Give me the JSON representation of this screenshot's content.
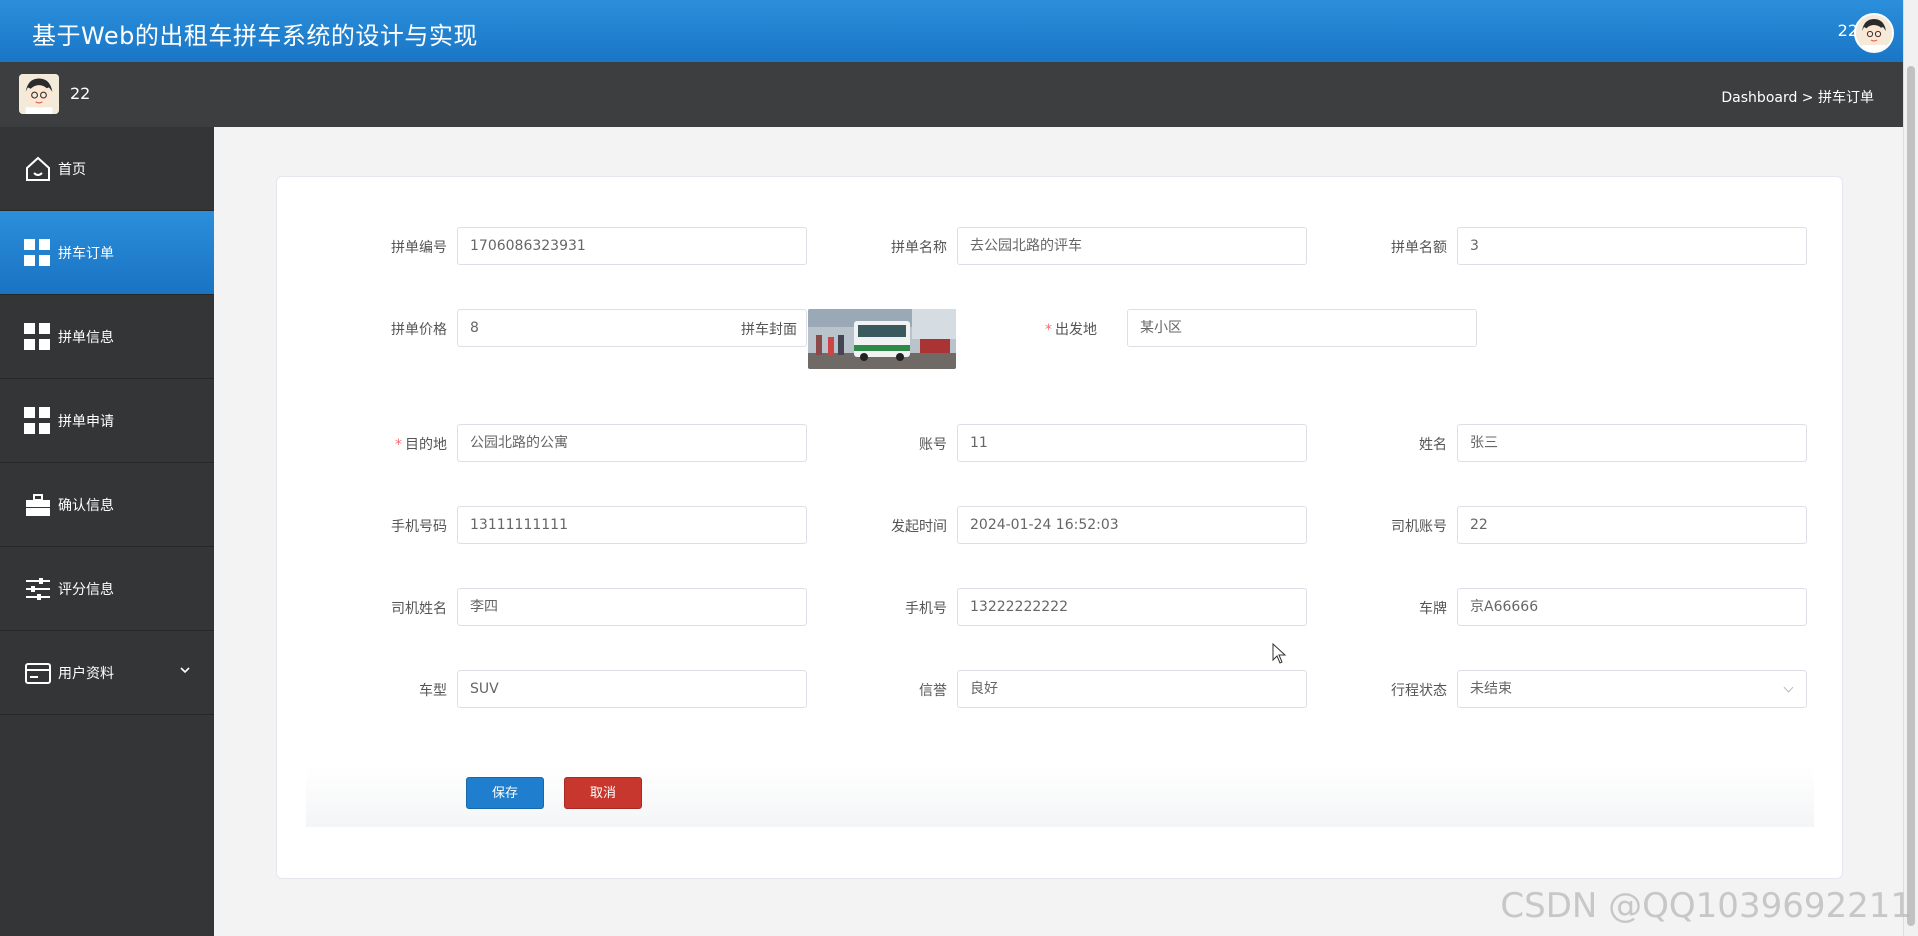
{
  "header": {
    "title": "基于Web的出租车拼车系统的设计与实现",
    "user": "22"
  },
  "subbar": {
    "name": "22",
    "breadcrumb": "Dashboard > 拼车订单"
  },
  "sidebar": {
    "items": [
      {
        "label": "首页",
        "icon": "home-icon"
      },
      {
        "label": "拼车订单",
        "icon": "grid-icon"
      },
      {
        "label": "拼单信息",
        "icon": "grid-icon"
      },
      {
        "label": "拼单申请",
        "icon": "grid-icon"
      },
      {
        "label": "确认信息",
        "icon": "briefcase-icon"
      },
      {
        "label": "评分信息",
        "icon": "sliders-icon"
      },
      {
        "label": "用户资料",
        "icon": "card-icon"
      }
    ]
  },
  "form": {
    "order_no": {
      "label": "拼单编号",
      "value": "1706086323931"
    },
    "order_name": {
      "label": "拼单名称",
      "value": "去公园北路的评车"
    },
    "quota": {
      "label": "拼单名额",
      "value": "3"
    },
    "price": {
      "label": "拼单价格",
      "value": "8"
    },
    "cover": {
      "label": "拼车封面"
    },
    "origin": {
      "label": "出发地",
      "value": "某小区",
      "required": "*"
    },
    "destination": {
      "label": "目的地",
      "value": "公园北路的公寓",
      "required": "*"
    },
    "account": {
      "label": "账号",
      "value": "11"
    },
    "name": {
      "label": "姓名",
      "value": "张三"
    },
    "phone": {
      "label": "手机号码",
      "value": "13111111111"
    },
    "start_time": {
      "label": "发起时间",
      "value": "2024-01-24 16:52:03"
    },
    "driver_account": {
      "label": "司机账号",
      "value": "22"
    },
    "driver_name": {
      "label": "司机姓名",
      "value": "李四"
    },
    "driver_phone": {
      "label": "手机号",
      "value": "13222222222"
    },
    "plate": {
      "label": "车牌",
      "value": "京A66666"
    },
    "car_type": {
      "label": "车型",
      "value": "SUV"
    },
    "credit": {
      "label": "信誉",
      "value": "良好"
    },
    "trip_status": {
      "label": "行程状态",
      "value": "未结束"
    }
  },
  "buttons": {
    "save": "保存",
    "cancel": "取消"
  },
  "watermark": "CSDN @QQ1039692211",
  "colors": {
    "header_blue": "#1f80d0",
    "sidebar_dark": "#333537",
    "save_blue": "#1f7fce",
    "cancel_red": "#c8372d"
  }
}
